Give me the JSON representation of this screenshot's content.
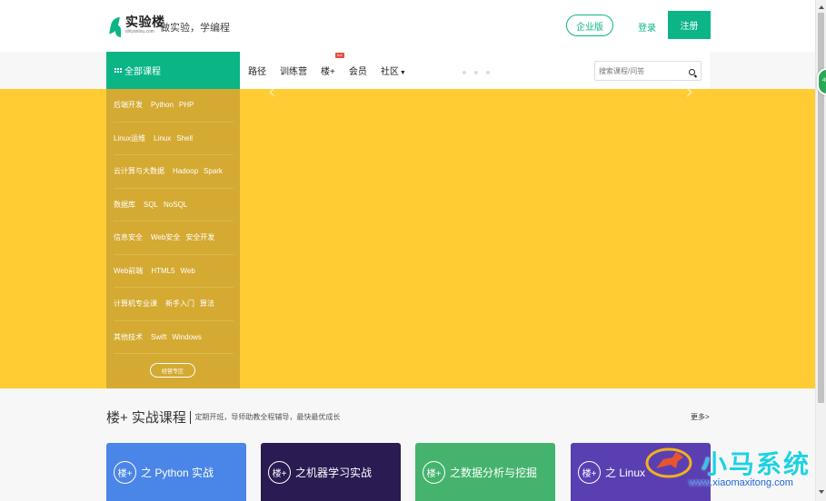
{
  "header": {
    "logo_name": "实验楼",
    "logo_url": "shiyanlou.com",
    "slogan": "做实验，学编程",
    "enterprise_label": "企业版",
    "login_label": "登录",
    "register_label": "注册"
  },
  "nav": {
    "all_courses_label": "全部课程",
    "items": [
      {
        "label": "路径"
      },
      {
        "label": "训练营"
      },
      {
        "label": "楼+",
        "badge": "hot"
      },
      {
        "label": "会员"
      },
      {
        "label": "社区"
      }
    ],
    "search_placeholder": "搜索课程/问答"
  },
  "categories": [
    {
      "main": "后端开发",
      "subs": [
        "Python",
        "PHP"
      ]
    },
    {
      "main": "Linux运维",
      "subs": [
        "Linux",
        "Shell"
      ]
    },
    {
      "main": "云计算与大数据",
      "subs": [
        "Hadoop",
        "Spark"
      ]
    },
    {
      "main": "数据库",
      "subs": [
        "SQL",
        "NoSQL"
      ]
    },
    {
      "main": "信息安全",
      "subs": [
        "Web安全",
        "安全开发"
      ]
    },
    {
      "main": "Web前端",
      "subs": [
        "HTML5",
        "Web"
      ]
    },
    {
      "main": "计算机专业课",
      "subs": [
        "新手入门",
        "算法"
      ]
    },
    {
      "main": "其他技术",
      "subs": [
        "Swift",
        "Windows"
      ]
    }
  ],
  "camp_label": "经营专区",
  "section": {
    "title": "楼+ 实战课程",
    "subtitle": "定期开班，导师助教全程辅导，最快最优成长",
    "more_label": "更多>"
  },
  "cards": [
    {
      "badge": "楼+",
      "title": "之 Python 实战"
    },
    {
      "badge": "楼+",
      "title": "之机器学习实战"
    },
    {
      "badge": "楼+",
      "title": "之数据分析与挖掘"
    },
    {
      "badge": "楼+",
      "title": "之 Linux"
    }
  ],
  "side_bubble": "49",
  "watermark": {
    "text": "小马系统",
    "url": "www.xiaomaxitong.com"
  },
  "colors": {
    "brand_green": "#0bb585",
    "banner_yellow": "#ffcc33",
    "category_bg": "#d4aa33"
  }
}
